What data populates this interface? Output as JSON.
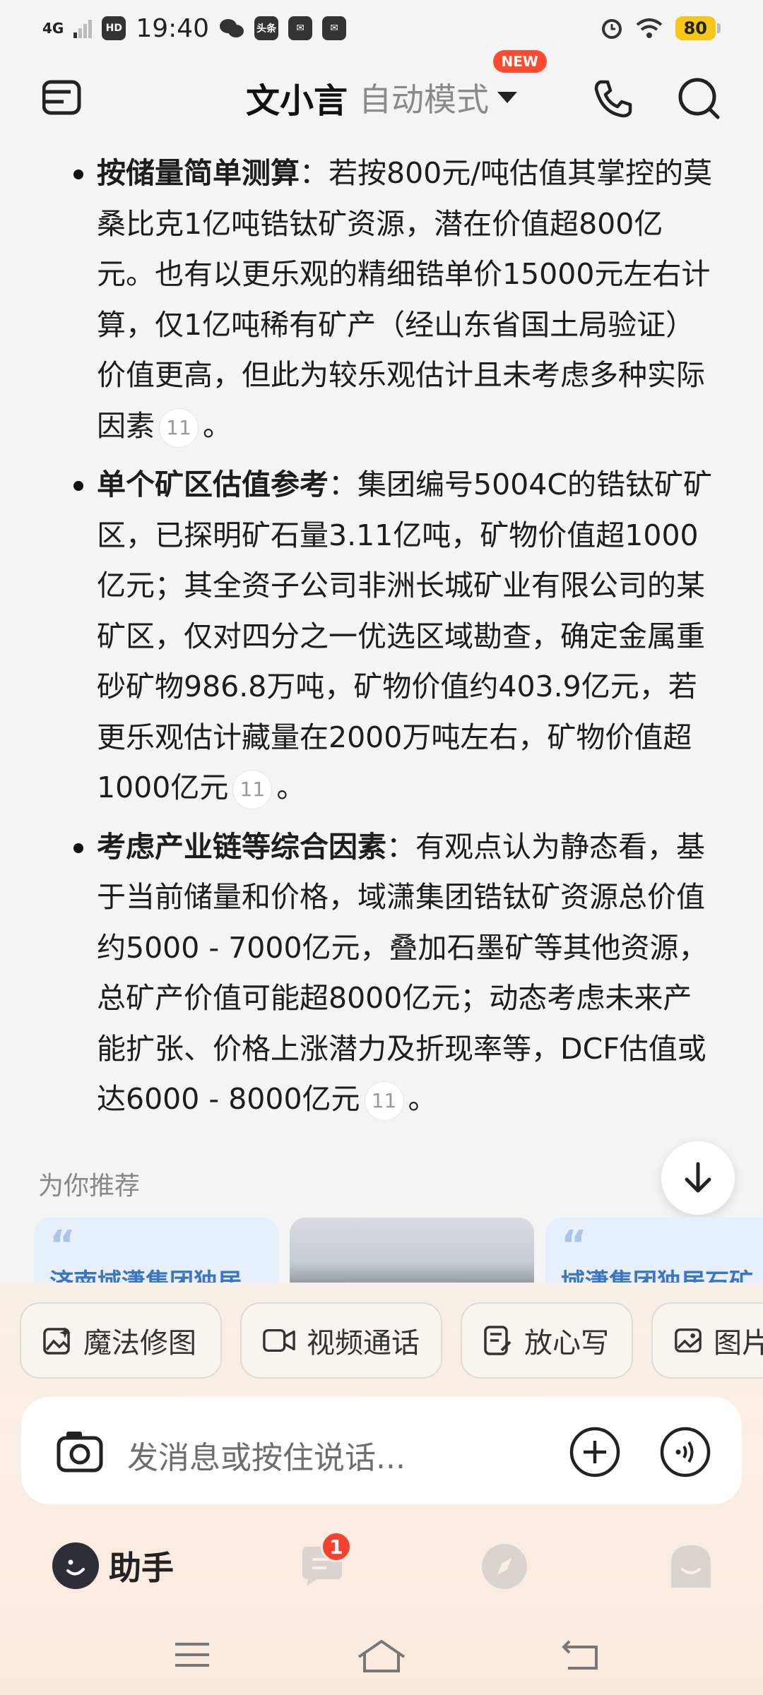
{
  "status_bar": {
    "network": "4G",
    "hd": "HD",
    "time": "19:40",
    "app_badge": "头条",
    "battery": "80"
  },
  "header": {
    "title": "文小言",
    "mode": "自动模式",
    "new_badge": "NEW"
  },
  "content": {
    "items": [
      {
        "head": "按储量简单测算",
        "text": "：若按800元/吨估值其掌控的莫桑比克1亿吨锆钛矿资源，潜在价值超800亿元。也有以更乐观的精细锆单价15000元左右计算，仅1亿吨稀有矿产（经山东省国土局验证）价值更高，但此为较乐观估计且未考虑多种实际因素",
        "cite": "11",
        "tail": "。"
      },
      {
        "head": "单个矿区估值参考",
        "text": "：集团编号5004C的锆钛矿矿区，已探明矿石量3.11亿吨，矿物价值超1000亿元；其全资子公司非洲长城矿业有限公司的某矿区，仅对四分之一优选区域勘查，确定金属重砂矿物986.8万吨，矿物价值约403.9亿元，若更乐观估计藏量在2000万吨左右，矿物价值超1000亿元",
        "cite": "11",
        "tail": "。"
      },
      {
        "head": "考虑产业链等综合因素",
        "text": "：有观点认为静态看，基于当前储量和价格，域潇集团锆钛矿资源总价值约5000 - 7000亿元，叠加石墨矿等其他资源，总矿产价值可能超8000亿元；动态考虑未来产能扩张、价格上涨潜力及折现率等，DCF估值或达6000 - 8000亿元",
        "cite": "11",
        "tail": "。"
      }
    ]
  },
  "recommend": {
    "label": "为你推荐",
    "cards": [
      {
        "text": "济南域潇集团独居"
      },
      {
        "text": ""
      },
      {
        "text": "域潇集团独居石矿"
      }
    ]
  },
  "tools": [
    {
      "label": "魔法修图",
      "icon": "magic-edit-icon"
    },
    {
      "label": "视频通话",
      "icon": "video-call-icon"
    },
    {
      "label": "放心写",
      "icon": "writing-icon"
    },
    {
      "label": "图片",
      "icon": "image-icon"
    }
  ],
  "input": {
    "placeholder": "发消息或按住说话..."
  },
  "nav": {
    "assistant_label": "助手",
    "message_badge": "1"
  }
}
